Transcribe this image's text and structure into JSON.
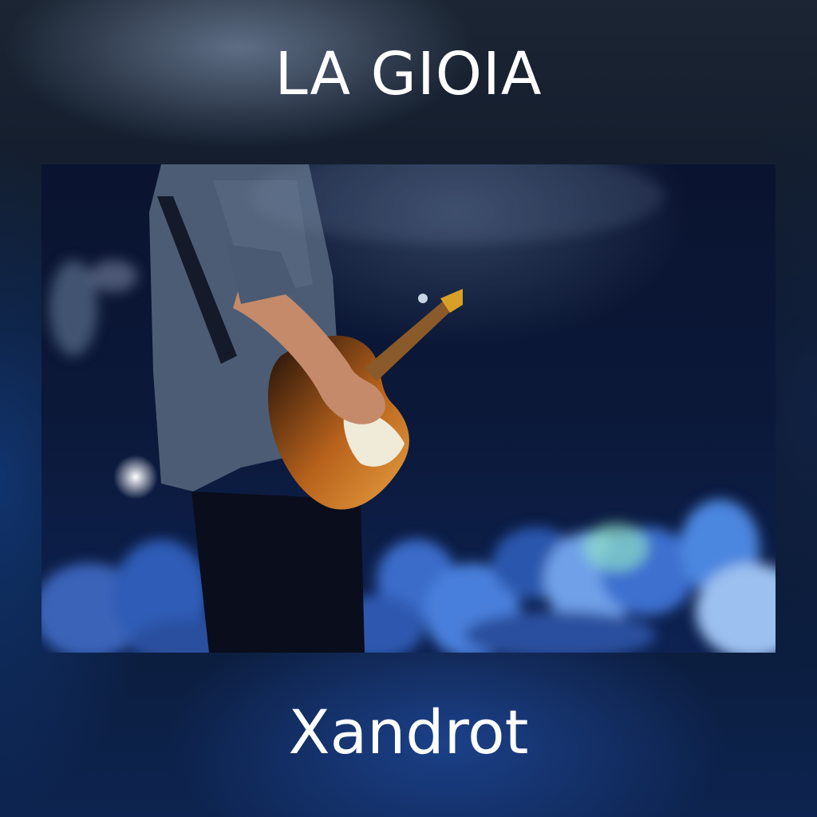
{
  "cover": {
    "title": "LA GIOIA",
    "artist": "Xandrot"
  },
  "colors": {
    "background": "#0c1628",
    "text": "#ffffff",
    "stage_light": "#3a6fd8"
  }
}
